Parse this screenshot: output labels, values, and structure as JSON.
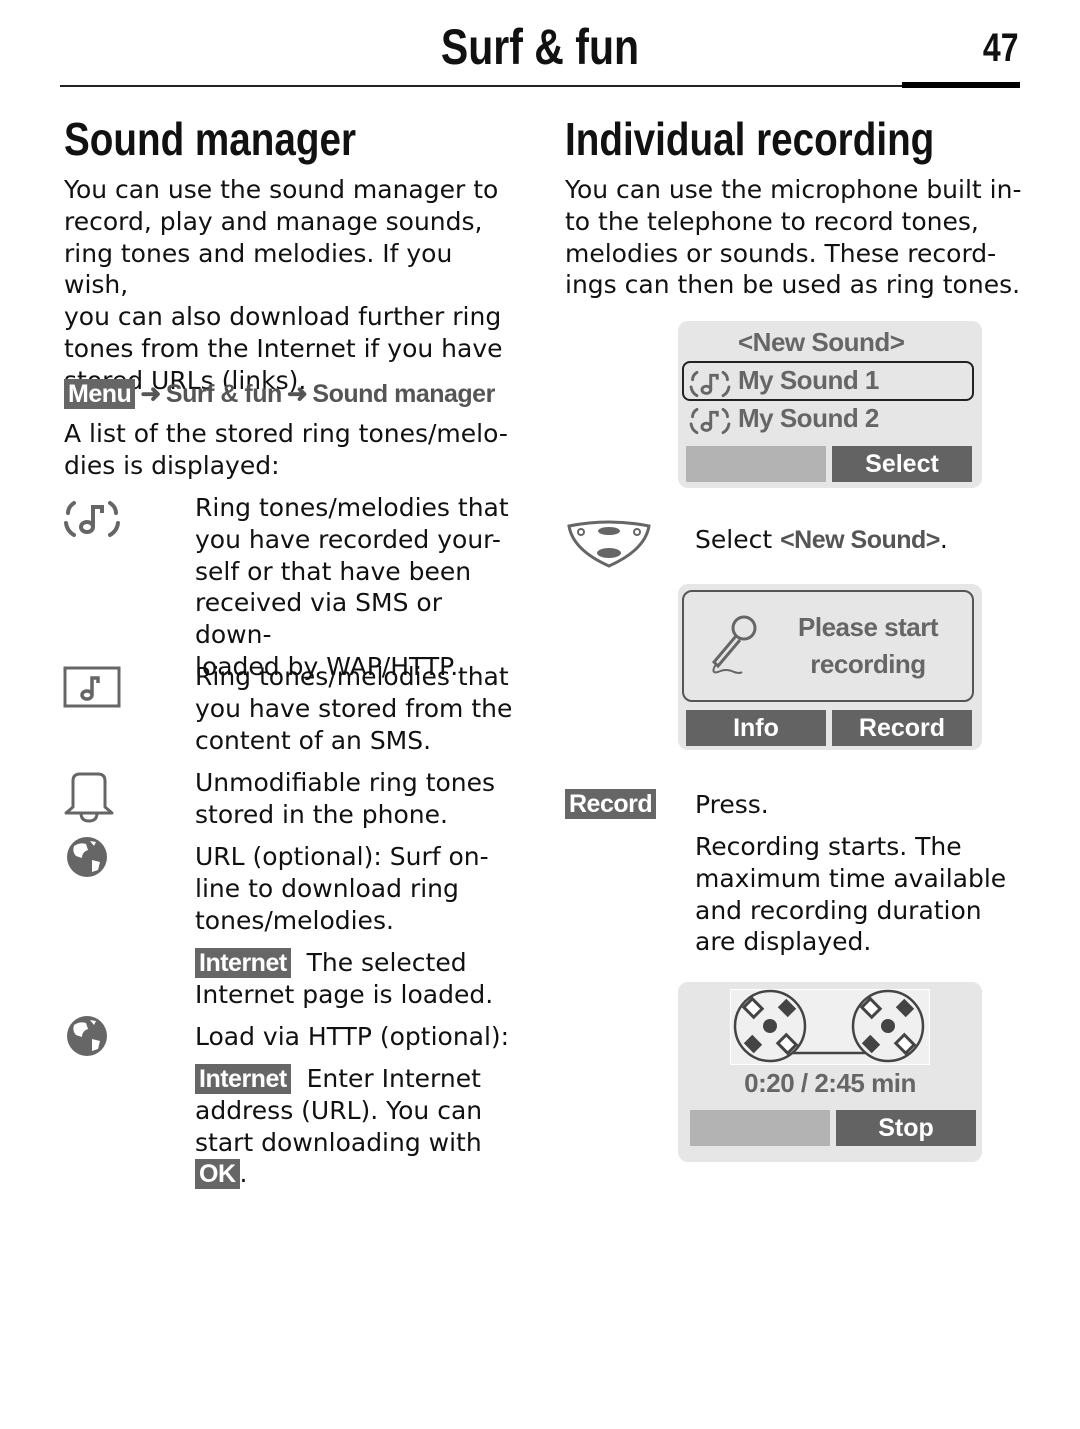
{
  "header": {
    "title": "Surf & fun",
    "page_number": "47"
  },
  "left": {
    "heading": "Sound manager",
    "intro_lines": [
      "You can use the sound manager to",
      "record, play and manage sounds,",
      "ring tones and melodies. If you wish,",
      "you can also download further ring",
      "tones from the Internet if you have",
      "stored URLs (links)."
    ],
    "nav_path": {
      "menu_key": "Menu",
      "arrow": "➜",
      "step1": "Surf & fun",
      "step2": "Sound manager"
    },
    "list_intro_lines": [
      "A list of the stored ring tones/melo-",
      "dies is displayed:"
    ],
    "items": [
      {
        "icon": "recorded-sound-icon",
        "lines": [
          "Ring tones/melodies that",
          "you have recorded your-",
          "self or that have been",
          "received via SMS or down-",
          "loaded by WAP/HTTP."
        ]
      },
      {
        "icon": "sms-tone-icon",
        "lines": [
          "Ring tones/melodies that",
          "you have stored from the",
          "content of an SMS."
        ]
      },
      {
        "icon": "bell-icon",
        "lines": [
          "Unmodifiable ring tones",
          "stored in the phone."
        ]
      },
      {
        "icon": "globe-icon",
        "lines": [
          "URL (optional): Surf on-",
          "line to download ring",
          "tones/melodies."
        ]
      },
      {
        "icon": "globe-icon",
        "lines": [
          "Load via HTTP (optional):"
        ]
      }
    ],
    "internet_note_1": {
      "key": "Internet",
      "text": "The selected",
      "line2": "Internet page is loaded."
    },
    "internet_note_2": {
      "key": "Internet",
      "text": "Enter Internet",
      "line2": "address (URL). You can",
      "line3": "start downloading with",
      "ok_key": "OK",
      "end": "."
    }
  },
  "right": {
    "heading": "Individual recording",
    "intro_lines": [
      "You can use the microphone built in-",
      "to the telephone to record tones,",
      "melodies or sounds. These record-",
      "ings can then be used as ring tones."
    ],
    "screen1": {
      "items": [
        "<New Sound>",
        "My Sound 1",
        "My Sound 2"
      ],
      "selected_index": 1,
      "softkey_left": "",
      "softkey_right": "Select"
    },
    "step_select": {
      "prefix": "Select ",
      "target": "<New Sound>",
      "suffix": "."
    },
    "screen2": {
      "message_line1": "Please start",
      "message_line2": "recording",
      "softkey_left": "Info",
      "softkey_right": "Record"
    },
    "step_record": {
      "key": "Record",
      "action": "Press.",
      "description_lines": [
        "Recording starts. The",
        "maximum time available",
        "and recording duration",
        "are displayed."
      ]
    },
    "screen3": {
      "time_readout": "0:20 / 2:45 min",
      "softkey_left": "",
      "softkey_right": "Stop"
    }
  }
}
